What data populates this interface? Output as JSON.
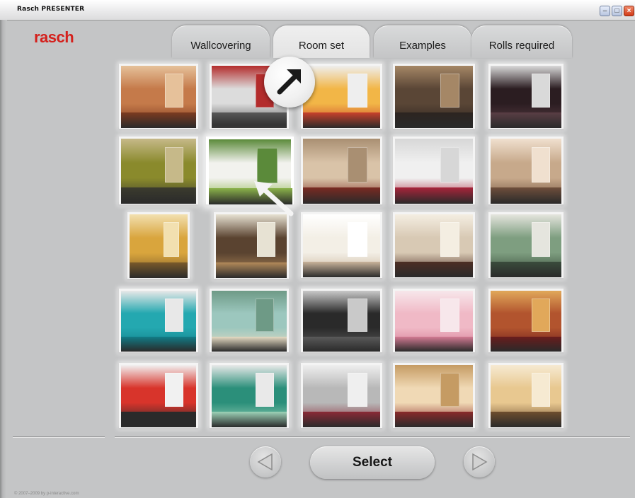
{
  "window": {
    "title": "Rasch PRESENTER"
  },
  "logo": {
    "text": "rasch",
    "color": "#d4201c"
  },
  "tabs": [
    {
      "label": "Wallcovering",
      "active": false
    },
    {
      "label": "Room set",
      "active": true
    },
    {
      "label": "Examples",
      "active": false
    },
    {
      "label": "Rolls required",
      "active": false
    }
  ],
  "grid": {
    "rows": 5,
    "columns": 5,
    "selected_index": 6,
    "items": [
      {
        "name": "room-set-1",
        "colors": [
          "#c57a4a",
          "#7c3b20",
          "#e6c19a"
        ]
      },
      {
        "name": "room-set-2",
        "colors": [
          "#dcdcdc",
          "#585858",
          "#b32c2c"
        ]
      },
      {
        "name": "room-set-3",
        "colors": [
          "#f2b647",
          "#c9412b",
          "#eeeeee"
        ]
      },
      {
        "name": "room-set-4",
        "colors": [
          "#5a4636",
          "#2c2420",
          "#a58766"
        ]
      },
      {
        "name": "room-set-5",
        "colors": [
          "#2b1d21",
          "#5a3e45",
          "#d9d9d9"
        ]
      },
      {
        "name": "room-set-6",
        "colors": [
          "#8a8a2c",
          "#3b3b2e",
          "#c6b989"
        ]
      },
      {
        "name": "room-set-7",
        "colors": [
          "#f2f2ee",
          "#8bb34a",
          "#5b8a3a"
        ]
      },
      {
        "name": "room-set-8",
        "colors": [
          "#d9c3a8",
          "#7a2a22",
          "#a98f72"
        ]
      },
      {
        "name": "room-set-9",
        "colors": [
          "#f0f0f0",
          "#a8243a",
          "#d7d7d7"
        ]
      },
      {
        "name": "room-set-10",
        "colors": [
          "#c7a98b",
          "#6e4e3b",
          "#f0e0cf"
        ]
      },
      {
        "name": "room-set-11",
        "colors": [
          "#d9a53d",
          "#7a5a2a",
          "#f2e0b0"
        ]
      },
      {
        "name": "room-set-12",
        "colors": [
          "#5a4330",
          "#b38a5a",
          "#e7e2d3"
        ]
      },
      {
        "name": "room-set-13",
        "colors": [
          "#f3efe6",
          "#c9b39b",
          "#ffffff"
        ]
      },
      {
        "name": "room-set-14",
        "colors": [
          "#d8c9b4",
          "#4d2e24",
          "#f4eee2"
        ]
      },
      {
        "name": "room-set-15",
        "colors": [
          "#7e9e80",
          "#3a4c3c",
          "#e5e5de"
        ]
      },
      {
        "name": "room-set-16",
        "colors": [
          "#24a8b0",
          "#117c86",
          "#e8e8e8"
        ]
      },
      {
        "name": "room-set-17",
        "colors": [
          "#9cc7be",
          "#e6dcc4",
          "#6e9a86"
        ]
      },
      {
        "name": "room-set-18",
        "colors": [
          "#2a2a2a",
          "#5a5a5a",
          "#c9c9c9"
        ]
      },
      {
        "name": "room-set-19",
        "colors": [
          "#f0b9c6",
          "#d27a93",
          "#f7e7eb"
        ]
      },
      {
        "name": "room-set-20",
        "colors": [
          "#b2542e",
          "#6a1c1c",
          "#e1a85a"
        ]
      },
      {
        "name": "room-set-21",
        "colors": [
          "#d8342b",
          "#2a2a2a",
          "#f1f1f1"
        ]
      },
      {
        "name": "room-set-22",
        "colors": [
          "#2b8f7a",
          "#9dd3b8",
          "#e9e9e9"
        ]
      },
      {
        "name": "room-set-23",
        "colors": [
          "#b8b8b8",
          "#8a2a36",
          "#efefef"
        ]
      },
      {
        "name": "room-set-24",
        "colors": [
          "#f0d9b5",
          "#8a2a2a",
          "#c59b63"
        ]
      },
      {
        "name": "room-set-25",
        "colors": [
          "#e8c890",
          "#6e4e2e",
          "#f6ead2"
        ]
      }
    ]
  },
  "controls": {
    "previous_icon": "arrow-left-icon",
    "next_icon": "arrow-right-icon",
    "select_label": "Select",
    "expand_icon": "expand-arrow-icon"
  }
}
